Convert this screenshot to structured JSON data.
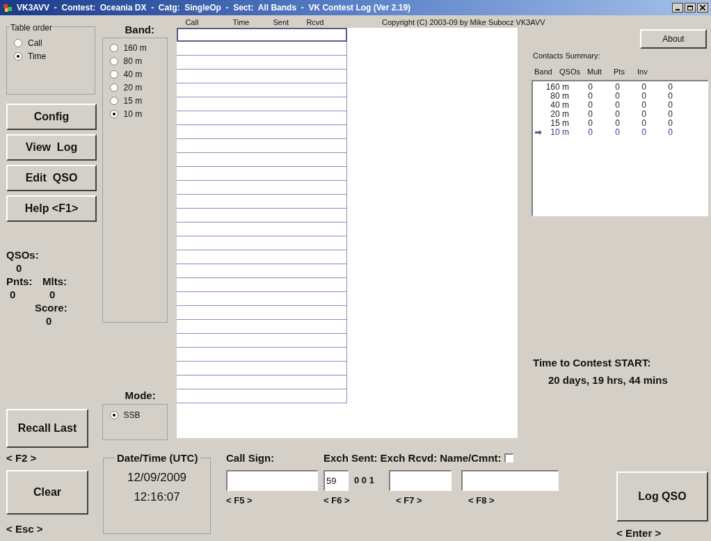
{
  "window": {
    "title": "VK3AVV  -  Contest:  Oceania DX  -  Catg:  SingleOp  -  Sect:  All Bands  -  VK Contest Log (Ver 2.19)"
  },
  "table_order": {
    "title": "Table order",
    "options": [
      {
        "label": "Call",
        "selected": false
      },
      {
        "label": "Time",
        "selected": true
      }
    ]
  },
  "buttons": [
    "Config",
    "View  Log",
    "Edit  QSO",
    "Help <F1>"
  ],
  "stats": {
    "qsos_label": "QSOs:",
    "qsos": "0",
    "pnts_label": "Pnts:",
    "pnts": "0",
    "mlts_label": "Mlts:",
    "mlts": "0",
    "score_label": "Score:",
    "score": "0"
  },
  "recall_button": "Recall Last",
  "band": {
    "title": "Band:",
    "options": [
      {
        "label": "160 m",
        "selected": false
      },
      {
        "label": "80 m",
        "selected": false
      },
      {
        "label": "40 m",
        "selected": false
      },
      {
        "label": "20 m",
        "selected": false
      },
      {
        "label": "15 m",
        "selected": false
      },
      {
        "label": "10 m",
        "selected": true
      }
    ]
  },
  "mode": {
    "title": "Mode:",
    "options": [
      {
        "label": "SSB",
        "selected": true
      }
    ]
  },
  "log_table": {
    "columns": [
      "Call",
      "Time",
      "Sent",
      "Rcvd"
    ],
    "rows": [
      {
        "selected": true
      },
      {
        "selected": false
      },
      {
        "selected": false
      },
      {
        "selected": false
      },
      {
        "selected": false
      },
      {
        "selected": false
      },
      {
        "selected": false
      },
      {
        "selected": false
      },
      {
        "selected": false
      },
      {
        "selected": false
      },
      {
        "selected": false
      },
      {
        "selected": false
      },
      {
        "selected": false
      },
      {
        "selected": false
      },
      {
        "selected": false
      },
      {
        "selected": false
      },
      {
        "selected": false
      },
      {
        "selected": false
      },
      {
        "selected": false
      },
      {
        "selected": false
      },
      {
        "selected": false
      },
      {
        "selected": false
      },
      {
        "selected": false
      },
      {
        "selected": false
      },
      {
        "selected": false
      },
      {
        "selected": false
      },
      {
        "selected": false
      }
    ]
  },
  "copyright": "Copyright (C) 2003-09 by Mike Subocz VK3AVV",
  "about_button": "About",
  "summary": {
    "title": "Contacts Summary:",
    "columns": [
      "Band",
      "QSOs",
      "Mult",
      "Pts",
      "Inv"
    ],
    "rows": [
      {
        "band": "160 m",
        "qsos": "0",
        "mult": "0",
        "pts": "0",
        "inv": "0",
        "current": false
      },
      {
        "band": "80 m",
        "qsos": "0",
        "mult": "0",
        "pts": "0",
        "inv": "0",
        "current": false
      },
      {
        "band": "40 m",
        "qsos": "0",
        "mult": "0",
        "pts": "0",
        "inv": "0",
        "current": false
      },
      {
        "band": "20 m",
        "qsos": "0",
        "mult": "0",
        "pts": "0",
        "inv": "0",
        "current": false
      },
      {
        "band": "15 m",
        "qsos": "0",
        "mult": "0",
        "pts": "0",
        "inv": "0",
        "current": false
      },
      {
        "band": "10 m",
        "qsos": "0",
        "mult": "0",
        "pts": "0",
        "inv": "0",
        "current": true
      }
    ]
  },
  "countdown": {
    "label": "Time to Contest START:",
    "value": "20 days, 19 hrs, 44 mins"
  },
  "bottom": {
    "f2": "< F2 >",
    "clear_button": "Clear",
    "esc": "< Esc >",
    "datetime": {
      "title": "Date/Time (UTC)",
      "date": "12/09/2009",
      "time": "12:16:07"
    },
    "call_sign": {
      "label": "Call Sign:",
      "key": "< F5 >"
    },
    "exch_sent": {
      "label": "Exch Sent:",
      "value": "59",
      "serial": "0 0 1",
      "key": "< F6 >"
    },
    "exch_rcvd": {
      "label": "Exch Rcvd:",
      "key": "< F7 >"
    },
    "name_cmnt": {
      "label": "Name/Cmnt:",
      "checked": false,
      "key": "< F8 >"
    },
    "log_button": "Log QSO",
    "enter": "< Enter >"
  }
}
